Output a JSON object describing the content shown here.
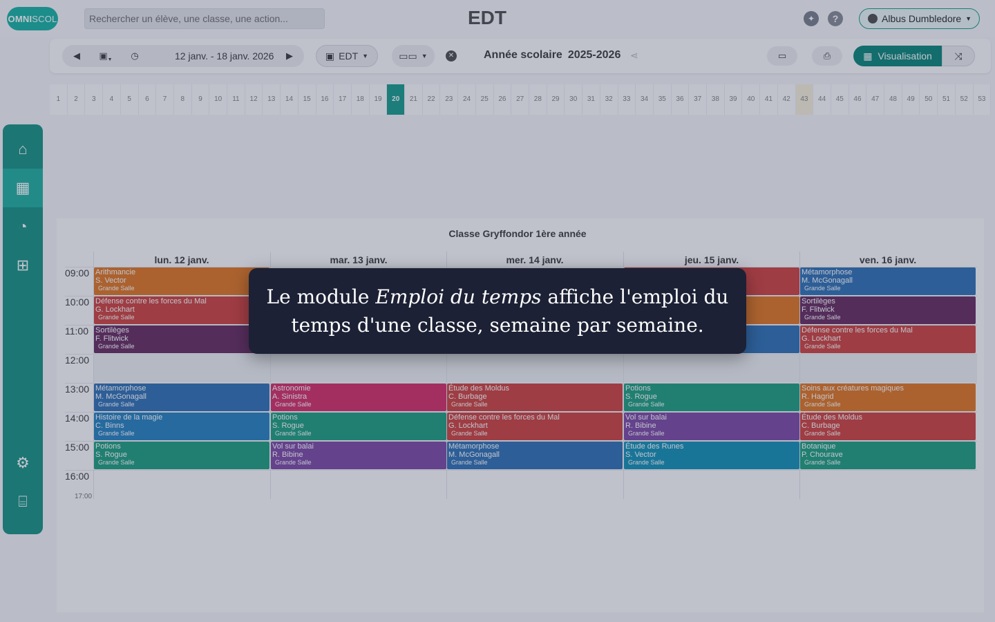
{
  "topbar": {
    "logo_bold": "OMNI",
    "logo_light": "SCOL",
    "search_placeholder": "Rechercher un élève, une classe, une action...",
    "app_title": "EDT",
    "user_name": "Albus Dumbledore"
  },
  "toolbar": {
    "date_range": "12 janv. - 18 janv. 2026",
    "view_label": "EDT",
    "school_year_label": "Année scolaire",
    "school_year_value": "2025-2026",
    "visualisation_label": "Visualisation"
  },
  "weeks": {
    "numbers": [
      "1",
      "2",
      "3",
      "4",
      "5",
      "6",
      "7",
      "8",
      "9",
      "10",
      "11",
      "12",
      "13",
      "14",
      "15",
      "16",
      "17",
      "18",
      "19",
      "20",
      "21",
      "22",
      "23",
      "24",
      "25",
      "26",
      "27",
      "28",
      "29",
      "30",
      "31",
      "32",
      "33",
      "34",
      "35",
      "36",
      "37",
      "38",
      "39",
      "40",
      "41",
      "42",
      "43",
      "44",
      "45",
      "46",
      "47",
      "48",
      "49",
      "50",
      "51",
      "52",
      "53"
    ],
    "current": "20",
    "highlighted": "43"
  },
  "timetable": {
    "class_title": "Classe Gryffondor 1ère année",
    "days": [
      "lun. 12 janv.",
      "mar. 13 janv.",
      "mer. 14 janv.",
      "jeu. 15 janv.",
      "ven. 16 janv."
    ],
    "hours": [
      "09:00",
      "10:00",
      "11:00",
      "12:00",
      "13:00",
      "14:00",
      "15:00",
      "16:00"
    ],
    "end_hour": "17:00",
    "events": [
      {
        "day": 0,
        "slot": 0,
        "subject": "Arithmancie",
        "teacher": "S. Vector",
        "room": "Grande Salle",
        "color": "#e07b2a"
      },
      {
        "day": 0,
        "slot": 1,
        "subject": "Défense contre les forces du Mal",
        "teacher": "G. Lockhart",
        "room": "Grande Salle",
        "color": "#cf4a45"
      },
      {
        "day": 0,
        "slot": 2,
        "subject": "Sortilèges",
        "teacher": "F. Flitwick",
        "room": "Grande Salle",
        "color": "#6b3466"
      },
      {
        "day": 0,
        "slot": 4,
        "subject": "Métamorphose",
        "teacher": "M. McGonagall",
        "room": "Grande Salle",
        "color": "#3676b6"
      },
      {
        "day": 0,
        "slot": 5,
        "subject": "Histoire de la magie",
        "teacher": "C. Binns",
        "room": "Grande Salle",
        "color": "#2d86c2"
      },
      {
        "day": 0,
        "slot": 6,
        "subject": "Potions",
        "teacher": "S. Rogue",
        "room": "Grande Salle",
        "color": "#25a383"
      },
      {
        "day": 1,
        "slot": 4,
        "subject": "Astronomie",
        "teacher": "A. Sinistra",
        "room": "Grande Salle",
        "color": "#d5366c"
      },
      {
        "day": 1,
        "slot": 5,
        "subject": "Potions",
        "teacher": "S. Rogue",
        "room": "Grande Salle",
        "color": "#25a383"
      },
      {
        "day": 1,
        "slot": 6,
        "subject": "Vol sur balai",
        "teacher": "R. Bibine",
        "room": "Grande Salle",
        "color": "#8150a8"
      },
      {
        "day": 2,
        "slot": 4,
        "subject": "Étude des Moldus",
        "teacher": "C. Burbage",
        "room": "Grande Salle",
        "color": "#cf4a45"
      },
      {
        "day": 2,
        "slot": 5,
        "subject": "Défense contre les forces du Mal",
        "teacher": "G. Lockhart",
        "room": "Grande Salle",
        "color": "#cf4a45"
      },
      {
        "day": 2,
        "slot": 6,
        "subject": "Métamorphose",
        "teacher": "M. McGonagall",
        "room": "Grande Salle",
        "color": "#3676b6"
      },
      {
        "day": 3,
        "slot": 0,
        "subject": "",
        "teacher": "",
        "room": "",
        "color": "#cf4a45"
      },
      {
        "day": 3,
        "slot": 1,
        "subject": "",
        "teacher": "",
        "room": "",
        "color": "#e07b2a"
      },
      {
        "day": 3,
        "slot": 2,
        "subject": "",
        "teacher": "",
        "room": "",
        "color": "#3676b6"
      },
      {
        "day": 3,
        "slot": 4,
        "subject": "Potions",
        "teacher": "S. Rogue",
        "room": "Grande Salle",
        "color": "#25a383"
      },
      {
        "day": 3,
        "slot": 5,
        "subject": "Vol sur balai",
        "teacher": "R. Bibine",
        "room": "Grande Salle",
        "color": "#8150a8"
      },
      {
        "day": 3,
        "slot": 6,
        "subject": "Étude des Runes",
        "teacher": "S. Vector",
        "room": "Grande Salle",
        "color": "#1c95b8"
      },
      {
        "day": 4,
        "slot": 0,
        "subject": "Métamorphose",
        "teacher": "M. McGonagall",
        "room": "Grande Salle",
        "color": "#3676b6"
      },
      {
        "day": 4,
        "slot": 1,
        "subject": "Sortilèges",
        "teacher": "F. Flitwick",
        "room": "Grande Salle",
        "color": "#6b3466"
      },
      {
        "day": 4,
        "slot": 2,
        "subject": "Défense contre les forces du Mal",
        "teacher": "G. Lockhart",
        "room": "Grande Salle",
        "color": "#cf4a45"
      },
      {
        "day": 4,
        "slot": 4,
        "subject": "Soins aux créatures magiques",
        "teacher": "R. Hagrid",
        "room": "Grande Salle",
        "color": "#e07b2a"
      },
      {
        "day": 4,
        "slot": 5,
        "subject": "Étude des Moldus",
        "teacher": "C. Burbage",
        "room": "Grande Salle",
        "color": "#cf4a45"
      },
      {
        "day": 4,
        "slot": 6,
        "subject": "Botanique",
        "teacher": "P. Chourave",
        "room": "Grande Salle",
        "color": "#25a383"
      }
    ]
  },
  "tooltip": {
    "before": "Le module ",
    "emphasis": "Emploi du temps",
    "after": " affiche l'emploi du temps d'une classe, semaine par semaine."
  },
  "icons": {
    "sidebar": [
      "home-icon",
      "calendar-icon",
      "dashboard-icon",
      "screen-add-icon",
      "settings-icon",
      "institution-icon"
    ]
  },
  "colors": {
    "brand": "#1fa090",
    "sidebar": "#1f9688",
    "tooltip_bg": "#1c2135"
  }
}
